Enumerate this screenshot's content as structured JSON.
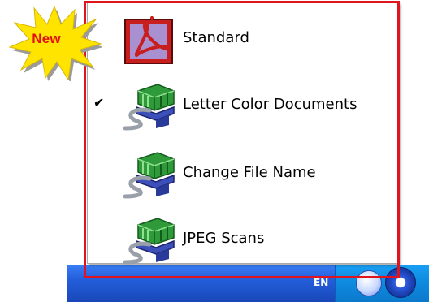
{
  "badge": {
    "text": "New"
  },
  "menu": {
    "items": [
      {
        "label": "Standard",
        "icon": "pdf-profile-icon",
        "checked": false
      },
      {
        "label": "Letter Color Documents",
        "icon": "scanner-profile-icon",
        "checked": true
      },
      {
        "label": "Change File Name",
        "icon": "scanner-profile-icon",
        "checked": false
      },
      {
        "label": "JPEG Scans",
        "icon": "scanner-profile-icon",
        "checked": false
      }
    ]
  },
  "taskbar": {
    "language": "EN"
  },
  "colors": {
    "highlight": "#e0141f",
    "badge_fill": "#ffe400",
    "badge_text": "#e01010",
    "taskbar": "#245edb"
  }
}
